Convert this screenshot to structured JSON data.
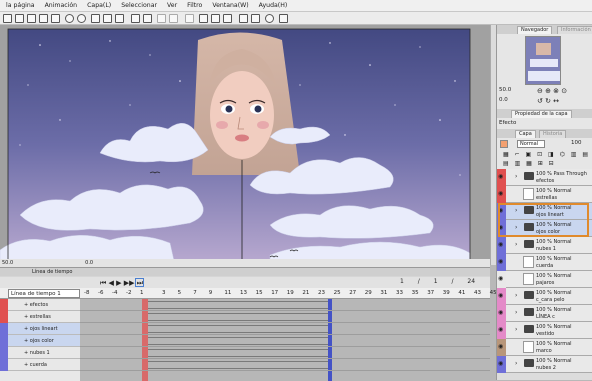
{
  "menu": [
    "la página",
    "Animación",
    "Capa(L)",
    "Seleccionar",
    "Ver",
    "Filtro",
    "Ventana(W)",
    "Ayuda(H)"
  ],
  "status": {
    "zoom": "50.0",
    "angle": "0.0",
    "coord": "0.0"
  },
  "timeline": {
    "title": "Línea de tiempo",
    "selector": "Línea de tiempo 1",
    "frames_before": [
      "-8",
      "-6",
      "-4",
      "-2",
      "1"
    ],
    "frames": [
      "3",
      "5",
      "7",
      "9",
      "11",
      "13",
      "15",
      "17",
      "19",
      "21",
      "23",
      "25",
      "27",
      "29",
      "31",
      "33",
      "35",
      "37",
      "39",
      "41",
      "43",
      "45"
    ],
    "counter": [
      "1",
      "/",
      "1",
      "/",
      "24"
    ],
    "tracks": [
      "efectos",
      "estrellas",
      "ojos lineart",
      "ojos color",
      "nubes 1",
      "cuerda"
    ]
  },
  "navigator": {
    "tab1": "Navegador",
    "tab2": "Información",
    "zoom": "50.0",
    "angle": "0.0"
  },
  "layer_props": {
    "title": "Propiedad de la capa",
    "effect_label": "Efecto"
  },
  "layer_panel": {
    "tab1": "Capa",
    "tab2": "Historia",
    "blend": "Normal",
    "opacity": "100"
  },
  "layers": [
    {
      "pct": "100 %",
      "mode": "Pass Through",
      "name": "efectos",
      "color": "#e05050",
      "type": "folder"
    },
    {
      "pct": "100 %",
      "mode": "Normal",
      "name": "estrellas",
      "color": "#e05050",
      "type": "layer"
    },
    {
      "pct": "100 %",
      "mode": "Normal",
      "name": "ojos lineart",
      "color": "#6f6fd8",
      "type": "folder",
      "selected": true
    },
    {
      "pct": "100 %",
      "mode": "Normal",
      "name": "ojos color",
      "color": "#6f6fd8",
      "type": "folder",
      "selected": true
    },
    {
      "pct": "100 %",
      "mode": "Normal",
      "name": "nubes 1",
      "color": "#6f6fd8",
      "type": "folder"
    },
    {
      "pct": "100 %",
      "mode": "Normal",
      "name": "cuerda",
      "color": "#6f6fd8",
      "type": "layer"
    },
    {
      "pct": "100 %",
      "mode": "Normal",
      "name": "pajaros",
      "color": "#e8e8e8",
      "type": "layer"
    },
    {
      "pct": "100 %",
      "mode": "Normal",
      "name": "c_cara pelo",
      "color": "#e48ac8",
      "type": "folder"
    },
    {
      "pct": "100 %",
      "mode": "Normal",
      "name": "LÍNEA c",
      "color": "#e48ac8",
      "type": "folder"
    },
    {
      "pct": "100 %",
      "mode": "Normal",
      "name": "vestido",
      "color": "#e48ac8",
      "type": "folder"
    },
    {
      "pct": "100 %",
      "mode": "Normal",
      "name": "marco",
      "color": "#b8967a",
      "type": "layer"
    },
    {
      "pct": "100 %",
      "mode": "Normal",
      "name": "nubes 2",
      "color": "#6f6fd8",
      "type": "folder"
    }
  ]
}
